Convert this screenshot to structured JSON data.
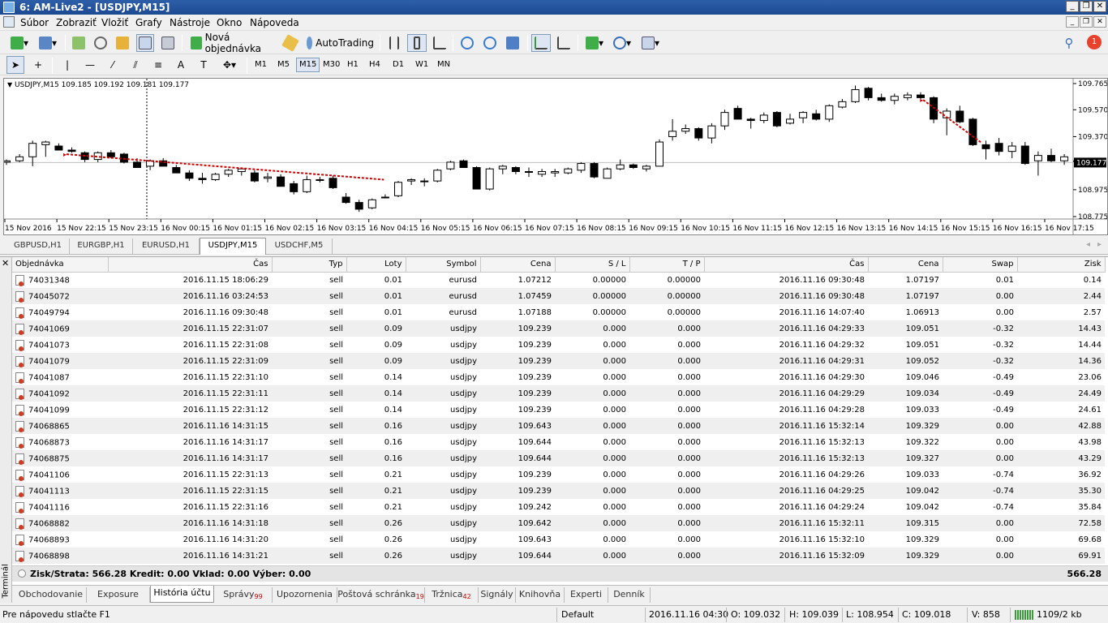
{
  "titlebar": {
    "title": "6: AM-Live2 - [USDJPY,M15]"
  },
  "menu": [
    "Súbor",
    "Zobraziť",
    "Vložiť",
    "Grafy",
    "Nástroje",
    "Okno",
    "Nápoveda"
  ],
  "toolbar": {
    "new_order": "Nová objednávka",
    "autotrading": "AutoTrading",
    "notification_count": "1"
  },
  "timeframes": [
    "M1",
    "M5",
    "M15",
    "M30",
    "H1",
    "H4",
    "D1",
    "W1",
    "MN"
  ],
  "active_timeframe": "M15",
  "chart": {
    "header": "USDJPY,M15  109.185 109.192 109.181 109.177",
    "current_price": "109.177",
    "price_labels": [
      "109.765",
      "109.570",
      "109.370",
      "108.975",
      "108.775"
    ],
    "time_labels": [
      "15 Nov 2016",
      "15 Nov 22:15",
      "15 Nov 23:15",
      "16 Nov 00:15",
      "16 Nov 01:15",
      "16 Nov 02:15",
      "16 Nov 03:15",
      "16 Nov 04:15",
      "16 Nov 05:15",
      "16 Nov 06:15",
      "16 Nov 07:15",
      "16 Nov 08:15",
      "16 Nov 09:15",
      "16 Nov 10:15",
      "16 Nov 11:15",
      "16 Nov 12:15",
      "16 Nov 13:15",
      "16 Nov 14:15",
      "16 Nov 15:15",
      "16 Nov 16:15",
      "16 Nov 17:15"
    ],
    "colors": {
      "bull": "#ffffff",
      "bear": "#000000",
      "trade_line": "#d40000",
      "price_line": "#c0c0c0"
    },
    "ohlc": [
      [
        109.18,
        109.2,
        109.16,
        109.19
      ],
      [
        109.19,
        109.24,
        109.18,
        109.22
      ],
      [
        109.22,
        109.34,
        109.15,
        109.32
      ],
      [
        109.31,
        109.34,
        109.22,
        109.33
      ],
      [
        109.3,
        109.32,
        109.27,
        109.27
      ],
      [
        109.27,
        109.29,
        109.25,
        109.26
      ],
      [
        109.25,
        109.26,
        109.18,
        109.2
      ],
      [
        109.2,
        109.26,
        109.18,
        109.25
      ],
      [
        109.25,
        109.27,
        109.21,
        109.22
      ],
      [
        109.24,
        109.25,
        109.17,
        109.18
      ],
      [
        109.18,
        109.21,
        109.14,
        109.14
      ],
      [
        109.15,
        109.2,
        109.12,
        109.19
      ],
      [
        109.19,
        109.21,
        109.15,
        109.15
      ],
      [
        109.14,
        109.16,
        109.11,
        109.1
      ],
      [
        109.1,
        109.12,
        109.04,
        109.06
      ],
      [
        109.06,
        109.1,
        109.02,
        109.05
      ],
      [
        109.05,
        109.1,
        109.04,
        109.09
      ],
      [
        109.09,
        109.13,
        109.07,
        109.12
      ],
      [
        109.11,
        109.14,
        109.08,
        109.13
      ],
      [
        109.1,
        109.12,
        109.03,
        109.04
      ],
      [
        109.06,
        109.1,
        109.03,
        109.07
      ],
      [
        109.07,
        109.09,
        109.0,
        109.0
      ],
      [
        109.02,
        109.04,
        108.94,
        108.96
      ],
      [
        108.96,
        109.08,
        108.95,
        109.05
      ],
      [
        109.05,
        109.07,
        109.03,
        109.05
      ],
      [
        109.06,
        109.08,
        108.98,
        108.99
      ],
      [
        108.92,
        108.95,
        108.87,
        108.88
      ],
      [
        108.88,
        108.9,
        108.81,
        108.83
      ],
      [
        108.84,
        108.91,
        108.83,
        108.9
      ],
      [
        108.92,
        108.94,
        108.91,
        108.92
      ],
      [
        108.93,
        109.04,
        108.92,
        109.03
      ],
      [
        109.04,
        109.06,
        109.01,
        109.05
      ],
      [
        109.04,
        109.06,
        109.0,
        109.04
      ],
      [
        109.04,
        109.13,
        109.03,
        109.12
      ],
      [
        109.13,
        109.19,
        109.12,
        109.18
      ],
      [
        109.19,
        109.2,
        109.14,
        109.14
      ],
      [
        109.14,
        109.15,
        108.98,
        108.98
      ],
      [
        108.98,
        109.14,
        108.97,
        109.13
      ],
      [
        109.13,
        109.16,
        109.09,
        109.15
      ],
      [
        109.14,
        109.15,
        109.09,
        109.11
      ],
      [
        109.11,
        109.14,
        109.07,
        109.11
      ],
      [
        109.09,
        109.13,
        109.07,
        109.11
      ],
      [
        109.1,
        109.13,
        109.07,
        109.11
      ],
      [
        109.1,
        109.14,
        109.09,
        109.13
      ],
      [
        109.12,
        109.18,
        109.1,
        109.17
      ],
      [
        109.17,
        109.18,
        109.06,
        109.07
      ],
      [
        109.06,
        109.14,
        109.06,
        109.13
      ],
      [
        109.13,
        109.2,
        109.12,
        109.16
      ],
      [
        109.16,
        109.17,
        109.13,
        109.14
      ],
      [
        109.13,
        109.16,
        109.11,
        109.15
      ],
      [
        109.15,
        109.35,
        109.15,
        109.33
      ],
      [
        109.37,
        109.5,
        109.34,
        109.41
      ],
      [
        109.41,
        109.46,
        109.39,
        109.43
      ],
      [
        109.43,
        109.44,
        109.34,
        109.36
      ],
      [
        109.36,
        109.47,
        109.32,
        109.45
      ],
      [
        109.45,
        109.57,
        109.42,
        109.55
      ],
      [
        109.58,
        109.6,
        109.5,
        109.5
      ],
      [
        109.5,
        109.51,
        109.43,
        109.49
      ],
      [
        109.49,
        109.55,
        109.47,
        109.53
      ],
      [
        109.55,
        109.56,
        109.44,
        109.45
      ],
      [
        109.47,
        109.54,
        109.46,
        109.5
      ],
      [
        109.51,
        109.56,
        109.47,
        109.55
      ],
      [
        109.54,
        109.57,
        109.49,
        109.5
      ],
      [
        109.5,
        109.61,
        109.48,
        109.6
      ],
      [
        109.59,
        109.65,
        109.58,
        109.63
      ],
      [
        109.63,
        109.75,
        109.62,
        109.72
      ],
      [
        109.73,
        109.74,
        109.64,
        109.66
      ],
      [
        109.66,
        109.69,
        109.63,
        109.64
      ],
      [
        109.64,
        109.69,
        109.61,
        109.67
      ],
      [
        109.66,
        109.7,
        109.64,
        109.68
      ],
      [
        109.68,
        109.7,
        109.65,
        109.66
      ],
      [
        109.66,
        109.67,
        109.47,
        109.5
      ],
      [
        109.51,
        109.58,
        109.38,
        109.56
      ],
      [
        109.56,
        109.6,
        109.47,
        109.48
      ],
      [
        109.5,
        109.51,
        109.3,
        109.31
      ],
      [
        109.31,
        109.34,
        109.2,
        109.28
      ],
      [
        109.32,
        109.36,
        109.23,
        109.26
      ],
      [
        109.26,
        109.33,
        109.21,
        109.3
      ],
      [
        109.3,
        109.33,
        109.16,
        109.17
      ],
      [
        109.19,
        109.26,
        109.08,
        109.23
      ],
      [
        109.23,
        109.28,
        109.18,
        109.19
      ],
      [
        109.19,
        109.24,
        109.16,
        109.22
      ],
      [
        109.19,
        109.2,
        109.18,
        109.19
      ]
    ],
    "trade_lines": [
      {
        "from_time_index": 4.6,
        "from_price": 109.239,
        "to_time_index": 28.9,
        "to_price": 109.05
      },
      {
        "from_time_index": 70.2,
        "from_price": 109.643,
        "to_time_index": 74.6,
        "to_price": 109.329
      }
    ]
  },
  "chart_tabs": [
    "GBPUSD,H1",
    "EURGBP,H1",
    "EURUSD,H1",
    "USDJPY,M15",
    "USDCHF,M5"
  ],
  "active_chart_tab": "USDJPY,M15",
  "table": {
    "columns": [
      "Objednávka",
      "Čas",
      "Typ",
      "Loty",
      "Symbol",
      "Cena",
      "S / L",
      "T / P",
      "Čas",
      "Cena",
      "Swap",
      "Zisk"
    ],
    "rows": [
      [
        "74031348",
        "2016.11.15 18:06:29",
        "sell",
        "0.01",
        "eurusd",
        "1.07212",
        "0.00000",
        "0.00000",
        "2016.11.16 09:30:48",
        "1.07197",
        "0.01",
        "0.14"
      ],
      [
        "74045072",
        "2016.11.16 03:24:53",
        "sell",
        "0.01",
        "eurusd",
        "1.07459",
        "0.00000",
        "0.00000",
        "2016.11.16 09:30:48",
        "1.07197",
        "0.00",
        "2.44"
      ],
      [
        "74049794",
        "2016.11.16 09:30:48",
        "sell",
        "0.01",
        "eurusd",
        "1.07188",
        "0.00000",
        "0.00000",
        "2016.11.16 14:07:40",
        "1.06913",
        "0.00",
        "2.57"
      ],
      [
        "74041069",
        "2016.11.15 22:31:07",
        "sell",
        "0.09",
        "usdjpy",
        "109.239",
        "0.000",
        "0.000",
        "2016.11.16 04:29:33",
        "109.051",
        "-0.32",
        "14.43"
      ],
      [
        "74041073",
        "2016.11.15 22:31:08",
        "sell",
        "0.09",
        "usdjpy",
        "109.239",
        "0.000",
        "0.000",
        "2016.11.16 04:29:32",
        "109.051",
        "-0.32",
        "14.44"
      ],
      [
        "74041079",
        "2016.11.15 22:31:09",
        "sell",
        "0.09",
        "usdjpy",
        "109.239",
        "0.000",
        "0.000",
        "2016.11.16 04:29:31",
        "109.052",
        "-0.32",
        "14.36"
      ],
      [
        "74041087",
        "2016.11.15 22:31:10",
        "sell",
        "0.14",
        "usdjpy",
        "109.239",
        "0.000",
        "0.000",
        "2016.11.16 04:29:30",
        "109.046",
        "-0.49",
        "23.06"
      ],
      [
        "74041092",
        "2016.11.15 22:31:11",
        "sell",
        "0.14",
        "usdjpy",
        "109.239",
        "0.000",
        "0.000",
        "2016.11.16 04:29:29",
        "109.034",
        "-0.49",
        "24.49"
      ],
      [
        "74041099",
        "2016.11.15 22:31:12",
        "sell",
        "0.14",
        "usdjpy",
        "109.239",
        "0.000",
        "0.000",
        "2016.11.16 04:29:28",
        "109.033",
        "-0.49",
        "24.61"
      ],
      [
        "74068865",
        "2016.11.16 14:31:15",
        "sell",
        "0.16",
        "usdjpy",
        "109.643",
        "0.000",
        "0.000",
        "2016.11.16 15:32:14",
        "109.329",
        "0.00",
        "42.88"
      ],
      [
        "74068873",
        "2016.11.16 14:31:17",
        "sell",
        "0.16",
        "usdjpy",
        "109.644",
        "0.000",
        "0.000",
        "2016.11.16 15:32:13",
        "109.322",
        "0.00",
        "43.98"
      ],
      [
        "74068875",
        "2016.11.16 14:31:17",
        "sell",
        "0.16",
        "usdjpy",
        "109.644",
        "0.000",
        "0.000",
        "2016.11.16 15:32:13",
        "109.327",
        "0.00",
        "43.29"
      ],
      [
        "74041106",
        "2016.11.15 22:31:13",
        "sell",
        "0.21",
        "usdjpy",
        "109.239",
        "0.000",
        "0.000",
        "2016.11.16 04:29:26",
        "109.033",
        "-0.74",
        "36.92"
      ],
      [
        "74041113",
        "2016.11.15 22:31:15",
        "sell",
        "0.21",
        "usdjpy",
        "109.239",
        "0.000",
        "0.000",
        "2016.11.16 04:29:25",
        "109.042",
        "-0.74",
        "35.30"
      ],
      [
        "74041116",
        "2016.11.15 22:31:16",
        "sell",
        "0.21",
        "usdjpy",
        "109.242",
        "0.000",
        "0.000",
        "2016.11.16 04:29:24",
        "109.042",
        "-0.74",
        "35.84"
      ],
      [
        "74068882",
        "2016.11.16 14:31:18",
        "sell",
        "0.26",
        "usdjpy",
        "109.642",
        "0.000",
        "0.000",
        "2016.11.16 15:32:11",
        "109.315",
        "0.00",
        "72.58"
      ],
      [
        "74068893",
        "2016.11.16 14:31:20",
        "sell",
        "0.26",
        "usdjpy",
        "109.643",
        "0.000",
        "0.000",
        "2016.11.16 15:32:10",
        "109.329",
        "0.00",
        "69.68"
      ],
      [
        "74068898",
        "2016.11.16 14:31:21",
        "sell",
        "0.26",
        "usdjpy",
        "109.644",
        "0.000",
        "0.000",
        "2016.11.16 15:32:09",
        "109.329",
        "0.00",
        "69.91"
      ]
    ],
    "summary": "Zisk/Strata: 566.28  Kredit: 0.00  Vklad: 0.00  Výber: 0.00",
    "total": "566.28"
  },
  "terminal_label": "Terminál",
  "terminal_tabs": [
    {
      "label": "Obchodovanie",
      "badge": ""
    },
    {
      "label": "Exposure",
      "badge": ""
    },
    {
      "label": "História účtu",
      "badge": ""
    },
    {
      "label": "Správy",
      "badge": "99"
    },
    {
      "label": "Upozornenia",
      "badge": ""
    },
    {
      "label": "Poštová schránka",
      "badge": "19"
    },
    {
      "label": "Tržnica",
      "badge": "42"
    },
    {
      "label": "Signály",
      "badge": ""
    },
    {
      "label": "Knihovňa",
      "badge": ""
    },
    {
      "label": "Experti",
      "badge": ""
    },
    {
      "label": "Denník",
      "badge": ""
    }
  ],
  "active_terminal_tab": "História účtu",
  "status": {
    "help": "Pre nápovedu stlačte F1",
    "profile": "Default",
    "datetime": "2016.11.16 04:30",
    "open": "O: 109.032",
    "high": "H: 109.039",
    "low": "L: 108.954",
    "close": "C: 109.018",
    "volume": "V: 858",
    "traffic": "1109/2 kb"
  }
}
